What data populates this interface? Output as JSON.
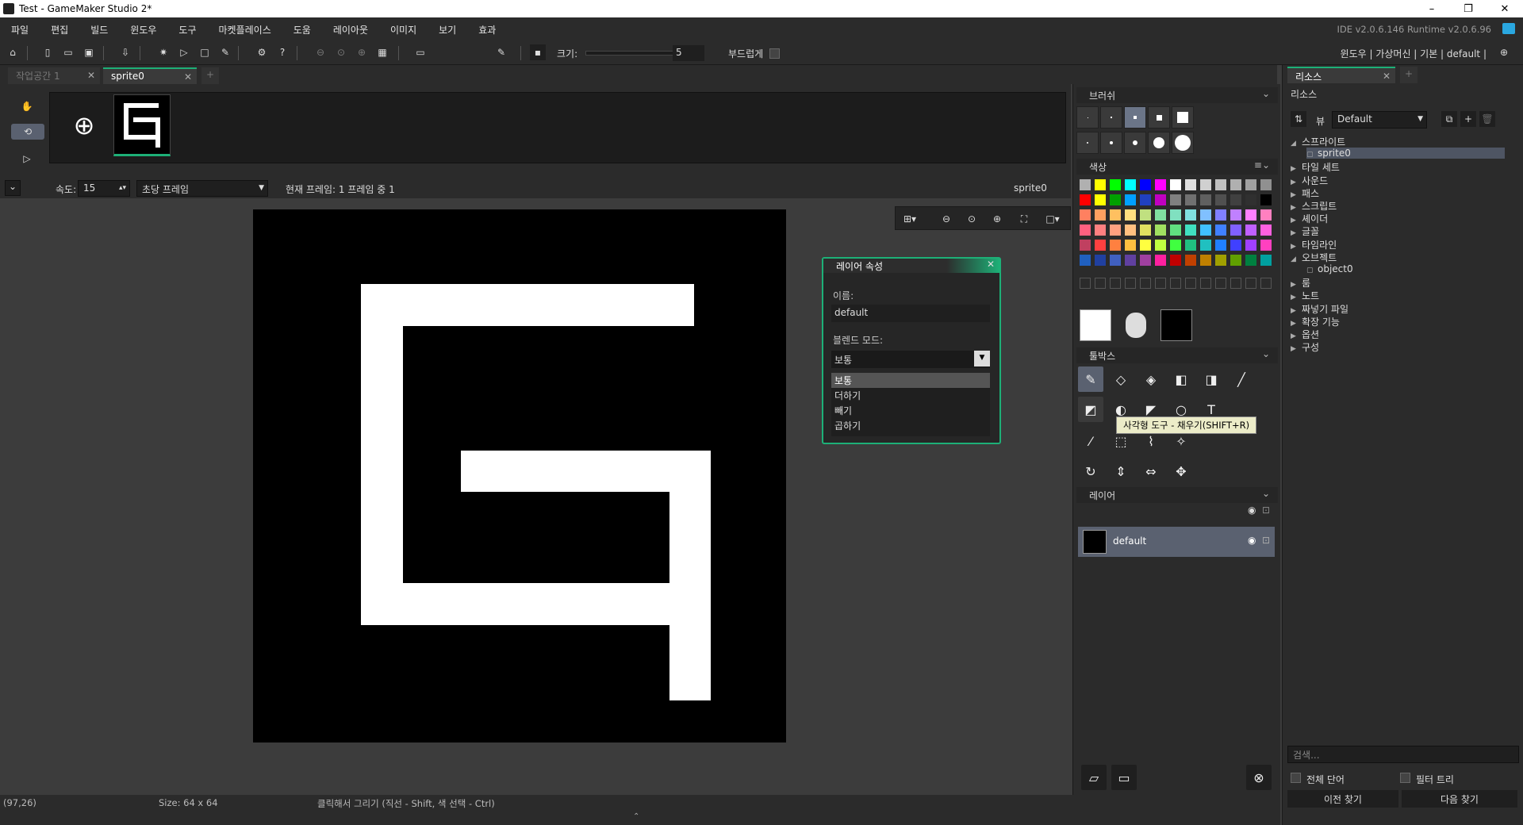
{
  "window": {
    "title": "Test - GameMaker Studio 2*",
    "minimize": "–",
    "maximize": "❐",
    "close": "✕"
  },
  "menu": {
    "items": [
      "파일",
      "편집",
      "빌드",
      "윈도우",
      "도구",
      "마켓플레이스",
      "도움",
      "레이아웃",
      "이미지",
      "보기",
      "효과"
    ],
    "version": "IDE v2.0.6.146 Runtime v2.0.6.96"
  },
  "toolbar": {
    "size_label": "크기:",
    "size_value": "5",
    "smooth_label": "부드럽게",
    "layouts": "윈도우 | 가상머신 | 기본 | default |"
  },
  "tabs": {
    "workspace": "작업공간 1",
    "sprite": "sprite0",
    "add": "+"
  },
  "animation": {
    "speed_label": "속도:",
    "speed_value": "15",
    "speed_mode": "초당 프레임",
    "frame_info": "현재 프레임: 1 프레임 중 1",
    "sprite_name": "sprite0"
  },
  "layer_props": {
    "title": "레이어 속성",
    "name_label": "이름:",
    "name_value": "default",
    "blend_label": "블렌드 모드:",
    "blend_value": "보통",
    "blend_options": [
      "보통",
      "더하기",
      "빼기",
      "곱하기"
    ]
  },
  "right_panel": {
    "brush_title": "브러쉬",
    "color_title": "색상",
    "toolbox_title": "툴박스",
    "layers_title": "레이어",
    "layer_name": "default",
    "tooltip": "사각형 도구 - 채우기(SHIFT+R)"
  },
  "palette": [
    [
      "#b0b0b0",
      "#ffff00",
      "#00ff00",
      "#00ffff",
      "#0000ff",
      "#ff00ff",
      "#ffffff",
      "#e0e0e0",
      "#d0d0d0",
      "#c0c0c0",
      "#b0b0b0",
      "#a0a0a0",
      "#909090"
    ],
    [
      "#ff0000",
      "#ffff00",
      "#00a000",
      "#00a0ff",
      "#2040c0",
      "#c000c0",
      "#808080",
      "#707070",
      "#606060",
      "#505050",
      "#404040",
      "#303030",
      "#000000"
    ],
    [
      "#ff8060",
      "#ffa060",
      "#ffc060",
      "#ffe080",
      "#c0e080",
      "#80e0a0",
      "#80e0c0",
      "#80e0e0",
      "#80c0ff",
      "#8080ff",
      "#c080ff",
      "#ff80ff",
      "#ff80c0"
    ],
    [
      "#ff6080",
      "#ff8080",
      "#ffa080",
      "#ffc080",
      "#e0e060",
      "#a0e060",
      "#60e080",
      "#40e0c0",
      "#40c0ff",
      "#4080ff",
      "#8060ff",
      "#c060ff",
      "#ff60e0"
    ],
    [
      "#c04060",
      "#ff4040",
      "#ff8040",
      "#ffc040",
      "#ffff40",
      "#c0ff40",
      "#40ff40",
      "#20c080",
      "#20c0c0",
      "#2080ff",
      "#4040ff",
      "#a040ff",
      "#ff40c0"
    ],
    [
      "#2060c0",
      "#2040a0",
      "#4060c0",
      "#6040a0",
      "#a040a0",
      "#ff20a0",
      "#c00000",
      "#c04000",
      "#c08000",
      "#a0a000",
      "#60a000",
      "#008040",
      "#00a0a0"
    ]
  ],
  "resources": {
    "tab": "리소스",
    "title": "리소스",
    "view_label": "뷰",
    "view_value": "Default",
    "tree": [
      {
        "label": "스프라이트",
        "expanded": true
      },
      {
        "label": "sprite0",
        "child": true,
        "selected": true
      },
      {
        "label": "타일 세트"
      },
      {
        "label": "사운드"
      },
      {
        "label": "패스"
      },
      {
        "label": "스크립트"
      },
      {
        "label": "셰이더"
      },
      {
        "label": "글꼴"
      },
      {
        "label": "타임라인"
      },
      {
        "label": "오브젝트",
        "expanded": true
      },
      {
        "label": "object0",
        "child": true
      },
      {
        "label": "룸"
      },
      {
        "label": "노트"
      },
      {
        "label": "짜넣기 파일"
      },
      {
        "label": "확장 기능"
      },
      {
        "label": "옵션"
      },
      {
        "label": "구성"
      }
    ],
    "search_placeholder": "검색...",
    "whole_word": "전체 단어",
    "filter_tree": "필터 트리",
    "prev": "이전 찾기",
    "next": "다음 찾기"
  },
  "status": {
    "coords": "(97,26)",
    "size": "Size: 64 x 64",
    "hint": "클릭해서 그리기 (직선 - Shift, 색 선택 - Ctrl)"
  }
}
